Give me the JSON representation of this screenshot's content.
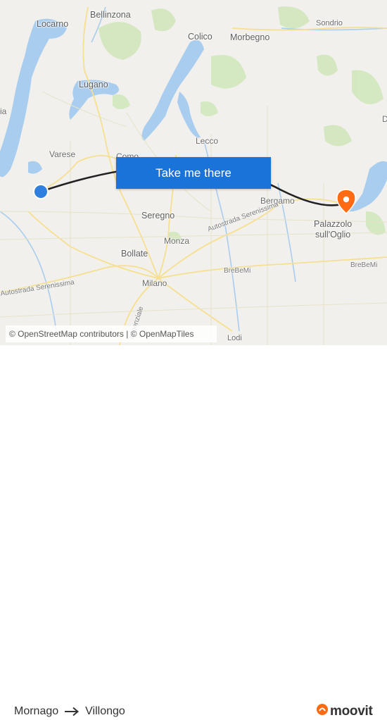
{
  "map": {
    "place_labels": [
      {
        "id": "bellinzona",
        "text": "Bellinzona"
      },
      {
        "id": "locarno",
        "text": "Locarno"
      },
      {
        "id": "sondrio",
        "text": "Sondrio"
      },
      {
        "id": "colico",
        "text": "Colico"
      },
      {
        "id": "morbegno",
        "text": "Morbegno"
      },
      {
        "id": "lugano",
        "text": "Lugano"
      },
      {
        "id": "varese",
        "text": "Varese"
      },
      {
        "id": "como",
        "text": "Como"
      },
      {
        "id": "lecco",
        "text": "Lecco"
      },
      {
        "id": "bergamo",
        "text": "Bergamo"
      },
      {
        "id": "seregno",
        "text": "Seregno"
      },
      {
        "id": "monza",
        "text": "Monza"
      },
      {
        "id": "bollate",
        "text": "Bollate"
      },
      {
        "id": "milano",
        "text": "Milano"
      },
      {
        "id": "palazzolo",
        "text": "Palazzolo\nsull'Oglio"
      },
      {
        "id": "lodi",
        "text": "Lodi"
      },
      {
        "id": "edge-left",
        "text": "ia"
      },
      {
        "id": "edge-right",
        "text": "D"
      }
    ],
    "road_labels": [
      {
        "id": "a4-east",
        "text": "Autostrada Serenissima"
      },
      {
        "id": "a4-west",
        "text": "Autostrada Serenissima"
      },
      {
        "id": "brebemi-1",
        "text": "BreBeMi"
      },
      {
        "id": "brebemi-2",
        "text": "BreBeMi"
      },
      {
        "id": "tangenziale",
        "text": "angenziale"
      }
    ],
    "origin_marker_color": "#2e7fe0",
    "destination_marker_color": "#ff6a13",
    "route_color": "#222222",
    "water_color": "#a9cdee",
    "forest_color": "#c6e1b0"
  },
  "cta": {
    "label": "Take me there"
  },
  "attribution": {
    "text": "© OpenStreetMap contributors | © OpenMapTiles"
  },
  "route": {
    "from": "Mornago",
    "to": "Villongo"
  },
  "brand": {
    "name": "moovit",
    "color": "#ff6a13"
  }
}
